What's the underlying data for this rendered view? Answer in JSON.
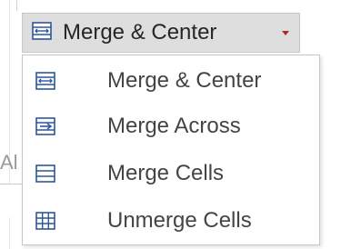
{
  "ribbon": {
    "split_button_label": "Merge & Center",
    "accent_color": "#2b579a",
    "arrow_color": "#b12a2a"
  },
  "background_fragment": "Al",
  "menu": {
    "items": [
      {
        "label": "Merge & Center",
        "icon": "merge-center-icon"
      },
      {
        "label": "Merge Across",
        "icon": "merge-across-icon"
      },
      {
        "label": "Merge Cells",
        "icon": "merge-cells-icon"
      },
      {
        "label": "Unmerge Cells",
        "icon": "unmerge-cells-icon"
      }
    ]
  }
}
